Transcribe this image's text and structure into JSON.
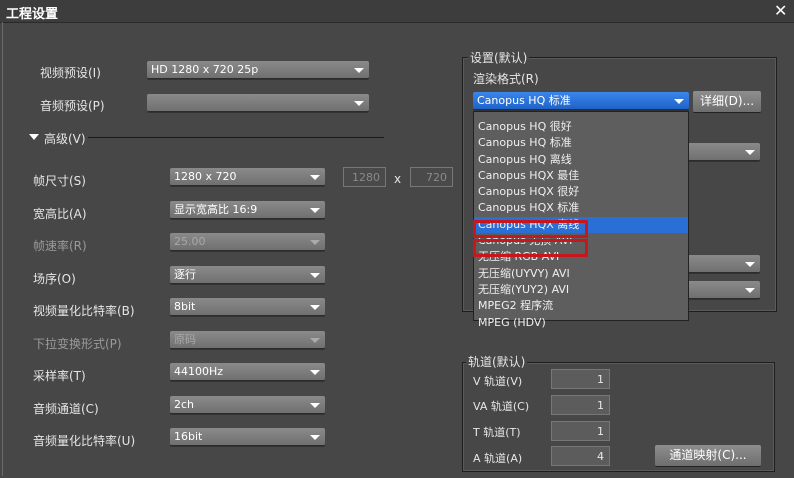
{
  "window": {
    "title": "工程设置",
    "close_icon": "close-icon"
  },
  "presets": {
    "video_label": "视频预设(I)",
    "video_value": "HD 1280 x 720 25p",
    "audio_label": "音频预设(P)",
    "audio_value": ""
  },
  "advanced": {
    "label": "高级(V)",
    "frame_size": {
      "label": "帧尺寸(S)",
      "value": "1280 x 720",
      "width": "1280",
      "x": "x",
      "height": "720"
    },
    "aspect": {
      "label": "宽高比(A)",
      "value": "显示宽高比 16:9"
    },
    "frame_rate": {
      "label": "帧速率(R)",
      "value": "25.00"
    },
    "field_order": {
      "label": "场序(O)",
      "value": "逐行"
    },
    "video_bits": {
      "label": "视频量化比特率(B)",
      "value": "8bit"
    },
    "pulldown": {
      "label": "下拉变换形式(P)",
      "value": "原码"
    },
    "sample_rate": {
      "label": "采样率(T)",
      "value": "44100Hz"
    },
    "audio_channels": {
      "label": "音频通道(C)",
      "value": "2ch"
    },
    "audio_bits": {
      "label": "音频量化比特率(U)",
      "value": "16bit"
    }
  },
  "settings": {
    "title": "设置(默认)",
    "render_label": "渲染格式(R)",
    "render_value": "Canopus HQ 标准",
    "details_button": "详细(D)...",
    "options": [
      "Canopus HQ 很好",
      "Canopus HQ 标准",
      "Canopus HQ 离线",
      "Canopus HQX 最佳",
      "Canopus HQX 很好",
      "Canopus HQX 标准",
      "Canopus HQX 离线",
      "Canopus 无损 AVI",
      "无压缩 RGB AVI",
      "无压缩(UYVY) AVI",
      "无压缩(YUY2) AVI",
      "MPEG2 程序流",
      "MPEG (HDV)"
    ],
    "highlighted_option": "Canopus HQX 离线",
    "annotated_options": [
      "Canopus 无损 AVI",
      "无压缩 RGB AVI"
    ],
    "annotation_color": "#c8161d",
    "highlight_color": "#2a6fd6"
  },
  "tracks": {
    "title": "轨道(默认)",
    "v_label": "V 轨道(V)",
    "v_value": "1",
    "va_label": "VA 轨道(C)",
    "va_value": "1",
    "t_label": "T 轨道(T)",
    "t_value": "1",
    "a_label": "A 轨道(A)",
    "a_value": "4",
    "mapping_button": "通道映射(C)..."
  }
}
